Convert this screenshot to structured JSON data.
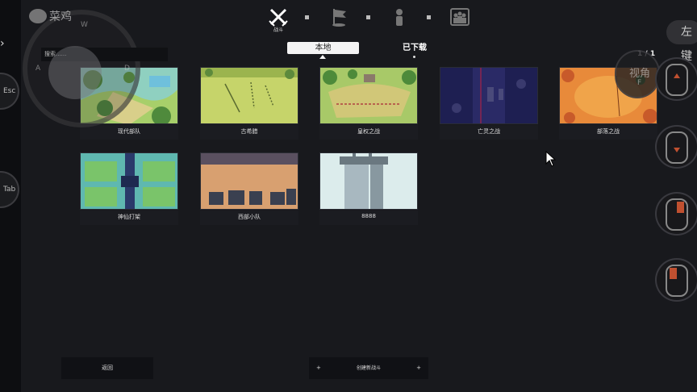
{
  "overlay": {
    "logo_text": "菜鸡",
    "joystick_keys": {
      "up": "W",
      "left": "A",
      "right": "D"
    },
    "esc_label": "Esc",
    "tab_label": "Tab",
    "right_pill_label": "左键",
    "view_label": "视角",
    "key_f": "F"
  },
  "modes": {
    "battle_caption": "战斗"
  },
  "search": {
    "placeholder": "搜索......"
  },
  "tabs": {
    "local": "本地",
    "downloaded": "已下载"
  },
  "pagination": "1 / 1",
  "maps": [
    {
      "label": "现代部队"
    },
    {
      "label": "古希腊"
    },
    {
      "label": "皇权之战"
    },
    {
      "label": "亡灵之战"
    },
    {
      "label": "部落之战"
    },
    {
      "label": "神仙打架"
    },
    {
      "label": "西部小队"
    },
    {
      "label": "8888"
    }
  ],
  "buttons": {
    "back": "返回",
    "create": "创建新战斗",
    "create_plus": "+"
  }
}
